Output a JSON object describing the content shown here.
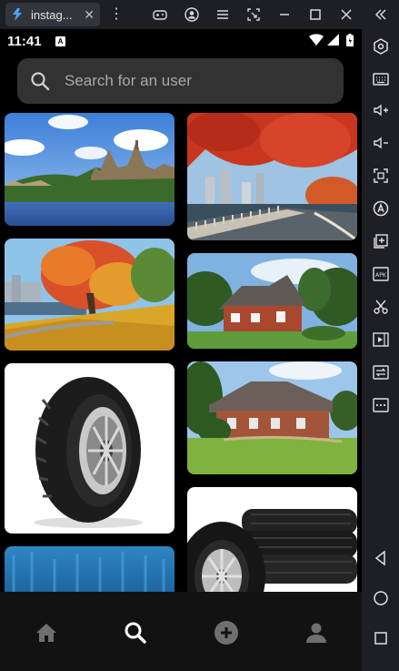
{
  "emulator": {
    "tab_title": "instag...",
    "tab_close": "✕",
    "menu_dots": "⋮",
    "notification_badge": "A",
    "side_buttons": [
      "settings-hex-icon",
      "keyboard-icon",
      "volume-up-icon",
      "volume-down-icon",
      "fullscreen-icon",
      "auto-rotate-icon",
      "add-window-icon",
      "apk-icon",
      "scissors-icon",
      "video-record-icon",
      "sync-icon",
      "more-icon",
      "back-triangle-icon",
      "home-circle-icon",
      "recents-square-icon"
    ]
  },
  "status_bar": {
    "time": "11:41"
  },
  "search": {
    "placeholder": "Search for an user"
  },
  "feed": {
    "left_column": [
      "parliament-lake-photo",
      "autumn-tree-park-photo",
      "tire-photo",
      "blue-water-photo"
    ],
    "right_column": [
      "autumn-city-boardwalk-photo",
      "brick-house-photo",
      "brick-house-lawn-photo",
      "stacked-tires-photo"
    ]
  },
  "bottom_nav": [
    "home",
    "search",
    "add",
    "profile"
  ],
  "colors": {
    "background": "#000000",
    "search_bg": "#323232",
    "nav_bg": "#121212",
    "emulator_chrome": "#1e1f24"
  }
}
